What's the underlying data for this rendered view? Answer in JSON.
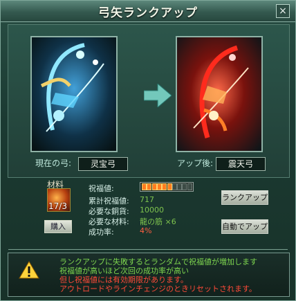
{
  "window": {
    "title": "弓矢ランクアップ",
    "close_icon": "close-icon"
  },
  "current": {
    "label": "現在の弓:",
    "name": "灵宝弓"
  },
  "after": {
    "label": "アップ後:",
    "name": "震天弓"
  },
  "material": {
    "heading": "材料",
    "count": "17/3",
    "buy_label": "購入"
  },
  "stats": [
    {
      "label": "祝福値:",
      "value": ""
    },
    {
      "label": "累計祝福値:",
      "value": "717"
    },
    {
      "label": "必要な銅貨:",
      "value": "10000"
    },
    {
      "label": "必要な材料:",
      "value": "龍の筋 ×6"
    },
    {
      "label": "成功率:",
      "value": "4%"
    }
  ],
  "blessing": {
    "filled_segments": 6,
    "total_segments": 10
  },
  "buttons": {
    "rank_up": "ランクアップ",
    "auto_up": "自動でアップ"
  },
  "notice": {
    "lines": [
      "ランクアップに失敗するとランダムで祝福値が増加します",
      "祝福値が高いほど次回の成功率が高い",
      "但し祝福値には有効期限があります。",
      "アウトロードやラインチェンジのときリセットされます。"
    ],
    "colors": [
      "#7ed64f",
      "#7ed64f",
      "#ff4a38",
      "#ff4a38"
    ]
  },
  "colors": {
    "accent": "#7ed64f",
    "warning": "#ff4a38"
  }
}
